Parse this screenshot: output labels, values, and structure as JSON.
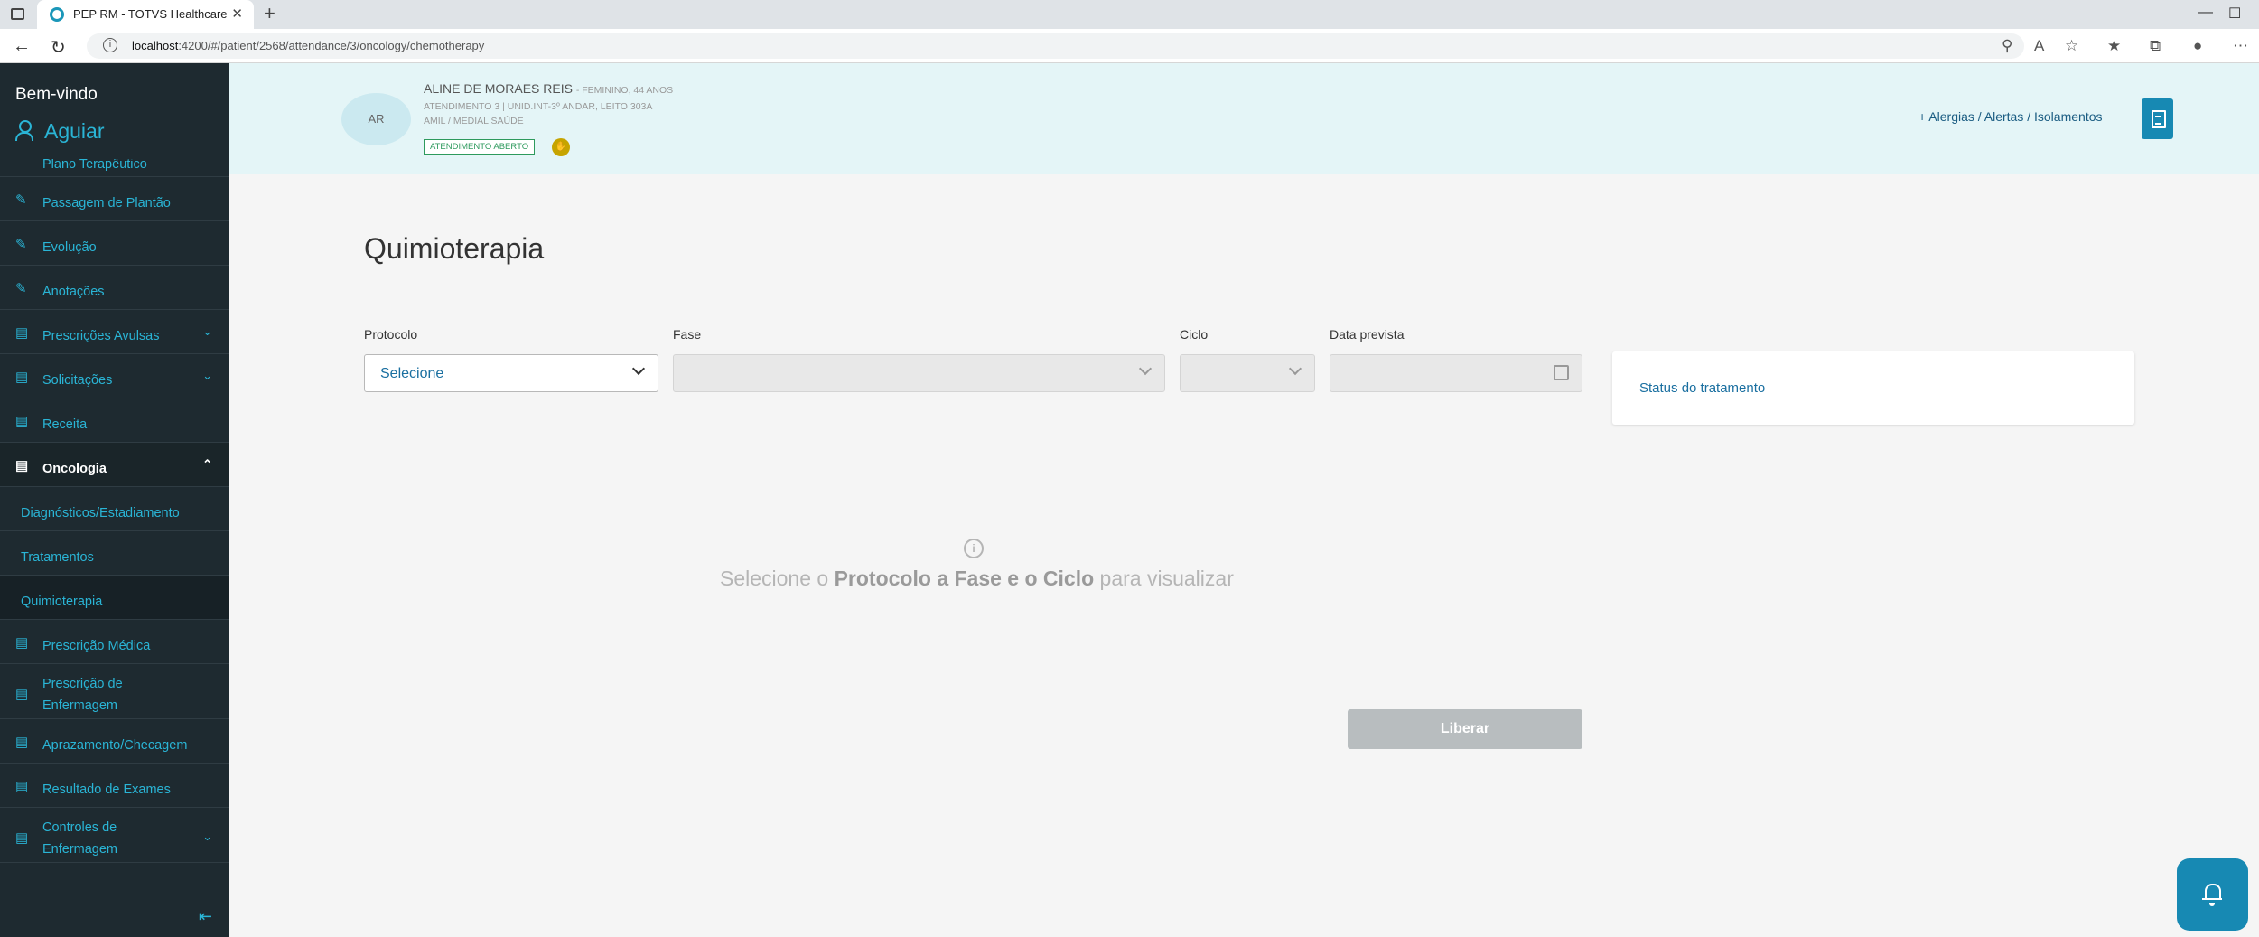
{
  "browser": {
    "tab_title": "PEP RM - TOTVS Healthcare",
    "url_host": "localhost",
    "url_rest": ":4200/#/patient/2568/attendance/3/oncology/chemotherapy"
  },
  "sidebar": {
    "welcome": "Bem-vindo",
    "user": "Aguiar",
    "items": [
      {
        "label": "Plano Terapêutico"
      },
      {
        "label": "Passagem de Plantão"
      },
      {
        "label": "Evolução"
      },
      {
        "label": "Anotações"
      },
      {
        "label": "Prescrições Avulsas"
      },
      {
        "label": "Solicitações"
      },
      {
        "label": "Receita"
      },
      {
        "label": "Oncologia"
      },
      {
        "label": "Diagnósticos/Estadiamento"
      },
      {
        "label": "Tratamentos"
      },
      {
        "label": "Quimioterapia"
      },
      {
        "label": "Prescrição Médica"
      },
      {
        "label": "Prescrição de Enfermagem"
      },
      {
        "label": "Aprazamento/Checagem"
      },
      {
        "label": "Resultado de Exames"
      },
      {
        "label": "Controles de Enfermagem"
      }
    ]
  },
  "patient": {
    "initials": "AR",
    "name": "ALINE DE MORAES REIS",
    "details": "- FEMININO, 44 ANOS",
    "attendance": "ATENDIMENTO 3 | UNID.INT-3º ANDAR, LEITO 303A",
    "insurance": "AMIL / MEDIAL SAÚDE",
    "status_badge": "ATENDIMENTO ABERTO",
    "alerts_link": "+ Alergias / Alertas / Isolamentos"
  },
  "main": {
    "title": "Quimioterapia",
    "fields": {
      "protocolo_label": "Protocolo",
      "protocolo_value": "Selecione",
      "fase_label": "Fase",
      "ciclo_label": "Ciclo",
      "data_label": "Data prevista"
    },
    "status_card": "Status do tratamento",
    "empty": {
      "p1": "Selecione o ",
      "b1": "Protocolo a Fase e o Ciclo",
      "p2": " para visualizar"
    },
    "release_button": "Liberar"
  },
  "colors": {
    "sidebar_bg": "#1e2a30",
    "accent": "#2ab5d6",
    "primary": "#1789b3",
    "header_bg": "#e4f5f7"
  }
}
